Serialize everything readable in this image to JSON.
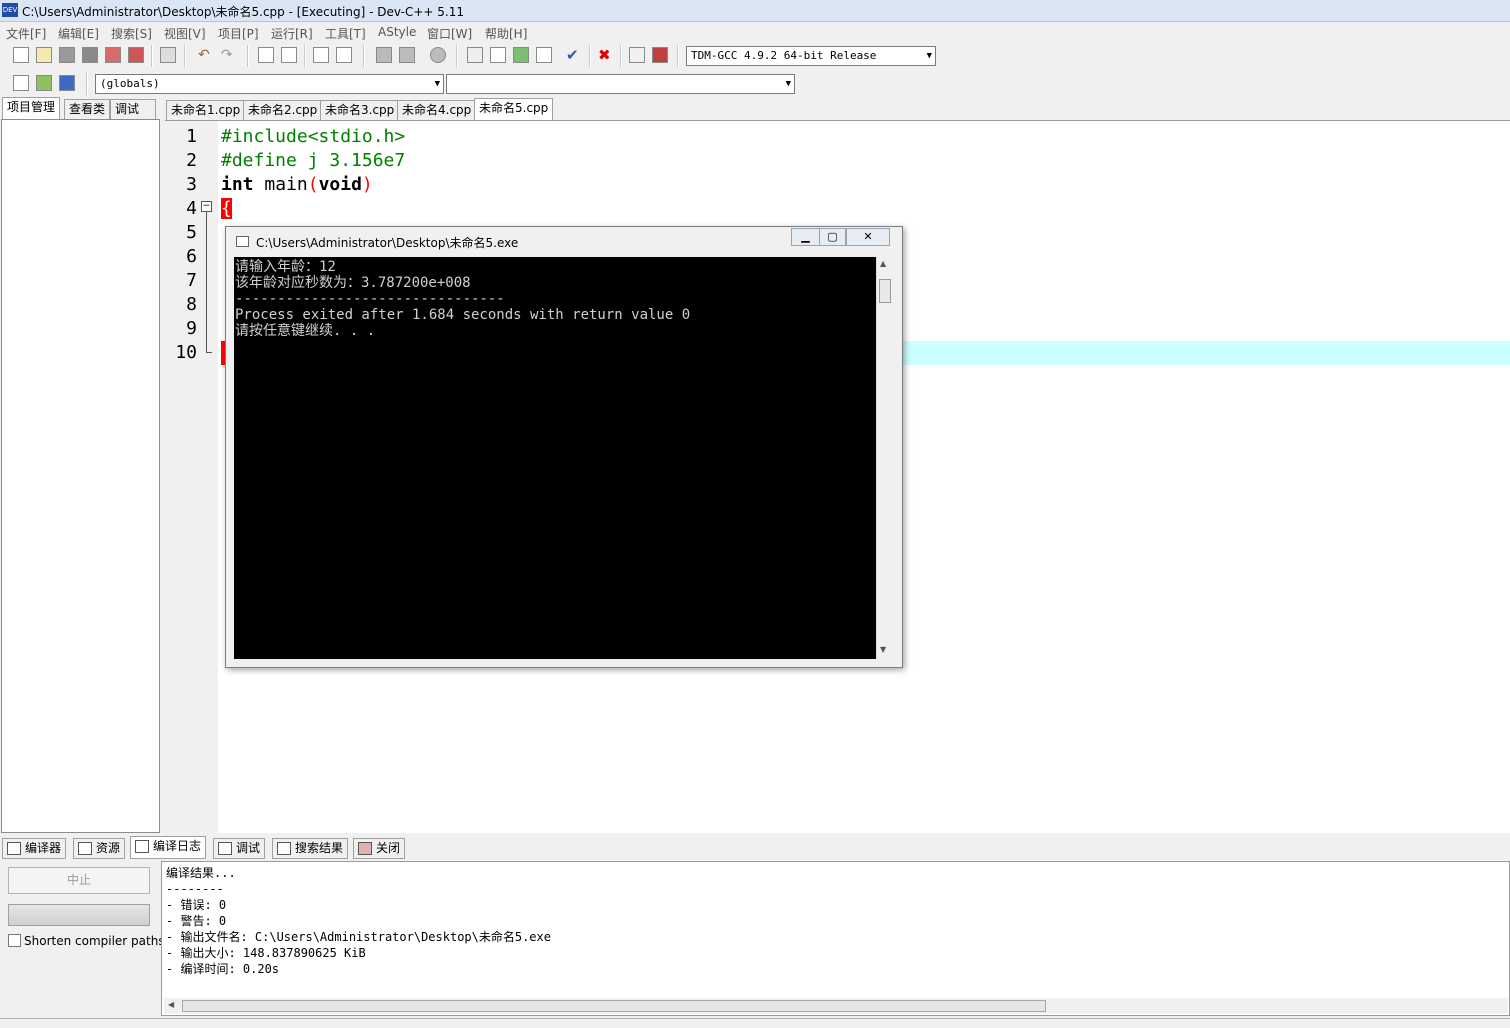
{
  "window": {
    "title": "C:\\Users\\Administrator\\Desktop\\未命名5.cpp - [Executing] - Dev-C++ 5.11",
    "app_icon": "DEV"
  },
  "menu": [
    "文件[F]",
    "编辑[E]",
    "搜索[S]",
    "视图[V]",
    "项目[P]",
    "运行[R]",
    "工具[T]",
    "AStyle",
    "窗口[W]",
    "帮助[H]"
  ],
  "toolbar": {
    "compiler": "TDM-GCC 4.9.2 64-bit Release",
    "scope": "(globals)",
    "function": ""
  },
  "left_tabs": [
    "项目管理",
    "查看类",
    "调试"
  ],
  "editor_tabs": [
    "未命名1.cpp",
    "未命名2.cpp",
    "未命名3.cpp",
    "未命名4.cpp",
    "未命名5.cpp"
  ],
  "active_editor_tab": 4,
  "editor": {
    "line_numbers": [
      "1",
      "2",
      "3",
      "4",
      "5",
      "6",
      "7",
      "8",
      "9",
      "10"
    ],
    "line1": "#include<stdio.h>",
    "line2": "#define j 3.156e7",
    "line3_kw": "int",
    "line3_name": "main",
    "line3_open": "(",
    "line3_arg": "void",
    "line3_close": ")",
    "line4": "{"
  },
  "console": {
    "title": "C:\\Users\\Administrator\\Desktop\\未命名5.exe",
    "lines": [
      "请输入年龄：12",
      "该年龄对应秒数为：3.787200e+008",
      "--------------------------------",
      "Process exited after 1.684 seconds with return value 0",
      "请按任意键继续. . ."
    ]
  },
  "bottom_tabs": [
    "编译器",
    "资源",
    "编译日志",
    "调试",
    "搜索结果",
    "关闭"
  ],
  "active_bottom_tab": 2,
  "bottom_left": {
    "stop_label": "中止",
    "shorten_label": "Shorten compiler paths"
  },
  "log": {
    "lines": [
      "编译结果...",
      "--------",
      "- 错误: 0",
      "- 警告: 0",
      "- 输出文件名: C:\\Users\\Administrator\\Desktop\\未命名5.exe",
      "- 输出大小: 148.837890625 KiB",
      "- 编译时间: 0.20s"
    ]
  }
}
